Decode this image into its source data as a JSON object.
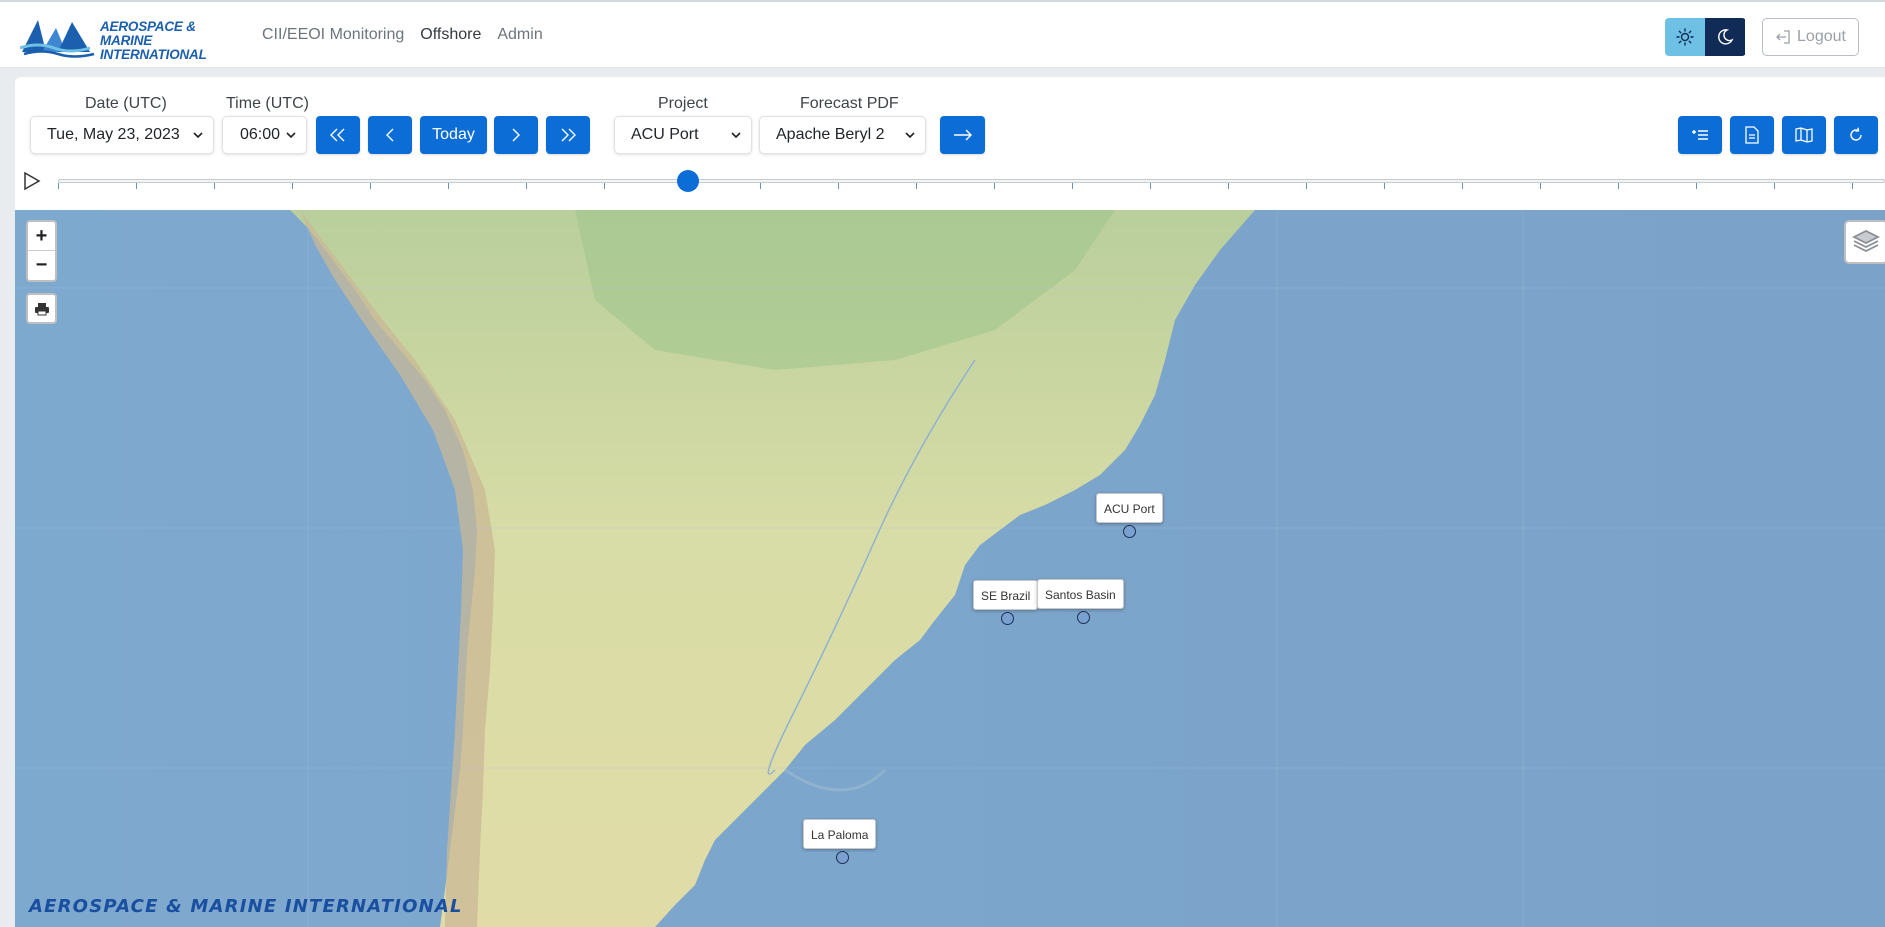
{
  "brand": {
    "line1": "AEROSPACE & MARINE",
    "line2": "INTERNATIONAL"
  },
  "nav": {
    "items": [
      {
        "label": "CII/EEOI Monitoring",
        "active": false
      },
      {
        "label": "Offshore",
        "active": true
      },
      {
        "label": "Admin",
        "active": false
      }
    ]
  },
  "theme": {
    "light_icon": "sun-icon",
    "dark_icon": "moon-icon"
  },
  "logout": {
    "label": "Logout",
    "icon": "logout-icon"
  },
  "controls": {
    "date": {
      "label": "Date (UTC)",
      "value": "Tue, May 23, 2023"
    },
    "time": {
      "label": "Time (UTC)",
      "value": "06:00"
    },
    "today_label": "Today",
    "project": {
      "label": "Project",
      "value": "ACU Port"
    },
    "forecast": {
      "label": "Forecast PDF",
      "value": "Apache Beryl 2"
    }
  },
  "timeline": {
    "tick_count": 24,
    "position": 0.345
  },
  "map": {
    "zoom_in": "+",
    "zoom_out": "−",
    "sites": [
      {
        "name": "ACU Port"
      },
      {
        "name": "SE Brazil"
      },
      {
        "name": "Santos Basin"
      },
      {
        "name": "La Paloma"
      }
    ],
    "watermark": "AEROSPACE & MARINE INTERNATIONAL"
  },
  "colors": {
    "primary": "#0d6dd6",
    "ocean": "#7fa6c9",
    "land": "#d9dca4",
    "dark_toggle": "#0f2b56",
    "light_toggle": "#6ec1e4"
  }
}
